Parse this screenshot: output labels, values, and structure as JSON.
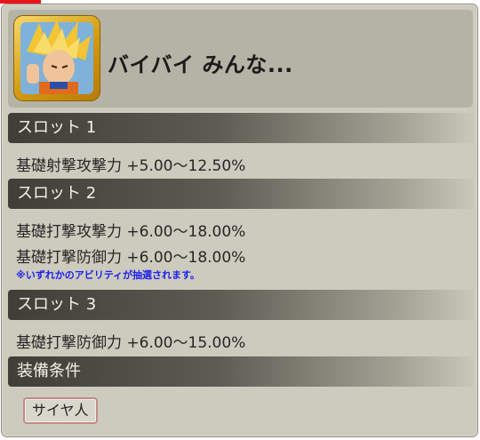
{
  "window": {
    "accent": "#e8161c"
  },
  "header": {
    "portrait_icon": "character-portrait",
    "title": "バイバイ みんな..."
  },
  "slots": [
    {
      "label": "スロット 1",
      "abilities": [
        "基礎射撃攻撃力 +5.00〜12.50%"
      ]
    },
    {
      "label": "スロット 2",
      "abilities": [
        "基礎打撃攻撃力 +6.00〜18.00%",
        "基礎打撃防御力 +6.00〜18.00%"
      ],
      "note": "※いずれかのアビリティが抽選されます。"
    },
    {
      "label": "スロット 3",
      "abilities": [
        "基礎打撃防御力 +6.00〜15.00%"
      ]
    }
  ],
  "requirements": {
    "label": "装備条件",
    "tag": "サイヤ人"
  },
  "colors": {
    "panel": "#cdcbbd",
    "note_text": "#1a1ef2",
    "tag_border": "#c58a8a"
  }
}
